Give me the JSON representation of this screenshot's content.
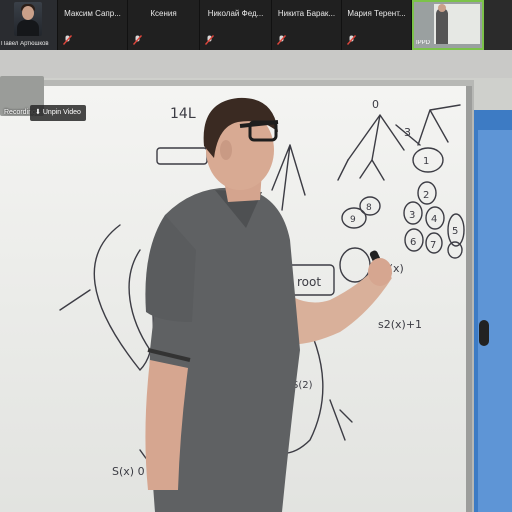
{
  "participants": [
    {
      "name": "Павел Артюшков",
      "active": false,
      "muted": true
    },
    {
      "name": "Максим Сапр...",
      "active": false,
      "muted": true
    },
    {
      "name": "Ксения",
      "active": false,
      "muted": true
    },
    {
      "name": "Николай Фед...",
      "active": false,
      "muted": true
    },
    {
      "name": "Никита Барак...",
      "active": false,
      "muted": true
    },
    {
      "name": "Мария Терент...",
      "active": false,
      "muted": true
    },
    {
      "name": "IPPD",
      "active": true,
      "muted": false
    }
  ],
  "overlay": {
    "recording_label": "Recording",
    "unpin_label": "Unpin Video"
  },
  "colors": {
    "active_border": "#7cc24a",
    "strip_bg": "#1c1c1c",
    "muted_icon": "#e0463c"
  },
  "board_text": {
    "top_left": "14L",
    "root": "root",
    "formula_a": "s2(x)",
    "formula_b": "s2(x)+1",
    "formula_c": "S(2)",
    "bottom_left": "S(x) 0",
    "digits": [
      "0",
      "1",
      "2",
      "3",
      "4",
      "5",
      "6",
      "7",
      "8",
      "9"
    ]
  }
}
